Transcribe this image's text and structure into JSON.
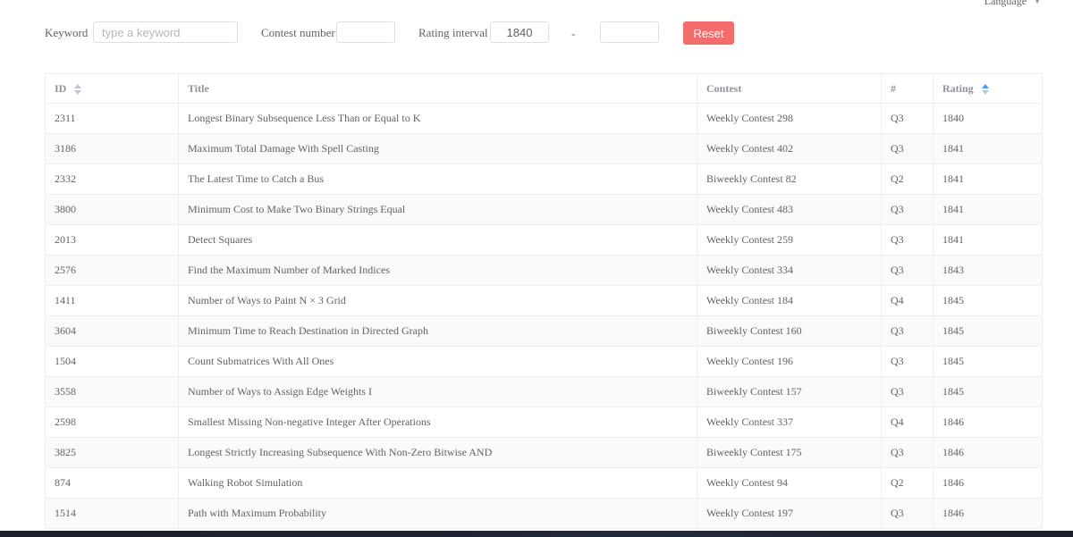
{
  "language": {
    "label": "Language"
  },
  "filters": {
    "keyword_label": "Keyword",
    "keyword_placeholder": "type a keyword",
    "keyword_value": "",
    "contest_label": "Contest number",
    "contest_value": "",
    "rating_label": "Rating interval",
    "rating_min": "1840",
    "rating_separator": "-",
    "rating_max": "",
    "reset_label": "Reset"
  },
  "table": {
    "columns": {
      "id": "ID",
      "title": "Title",
      "contest": "Contest",
      "num": "#",
      "rating": "Rating"
    },
    "rows": [
      {
        "id": "2311",
        "title": "Longest Binary Subsequence Less Than or Equal to K",
        "contest": "Weekly Contest 298",
        "q": "Q3",
        "rating": "1840"
      },
      {
        "id": "3186",
        "title": "Maximum Total Damage With Spell Casting",
        "contest": "Weekly Contest 402",
        "q": "Q3",
        "rating": "1841"
      },
      {
        "id": "2332",
        "title": "The Latest Time to Catch a Bus",
        "contest": "Biweekly Contest 82",
        "q": "Q2",
        "rating": "1841"
      },
      {
        "id": "3800",
        "title": "Minimum Cost to Make Two Binary Strings Equal",
        "contest": "Weekly Contest 483",
        "q": "Q3",
        "rating": "1841"
      },
      {
        "id": "2013",
        "title": "Detect Squares",
        "contest": "Weekly Contest 259",
        "q": "Q3",
        "rating": "1841"
      },
      {
        "id": "2576",
        "title": "Find the Maximum Number of Marked Indices",
        "contest": "Weekly Contest 334",
        "q": "Q3",
        "rating": "1843"
      },
      {
        "id": "1411",
        "title": "Number of Ways to Paint N × 3 Grid",
        "contest": "Weekly Contest 184",
        "q": "Q4",
        "rating": "1845"
      },
      {
        "id": "3604",
        "title": "Minimum Time to Reach Destination in Directed Graph",
        "contest": "Biweekly Contest 160",
        "q": "Q3",
        "rating": "1845"
      },
      {
        "id": "1504",
        "title": "Count Submatrices With All Ones",
        "contest": "Weekly Contest 196",
        "q": "Q3",
        "rating": "1845"
      },
      {
        "id": "3558",
        "title": "Number of Ways to Assign Edge Weights I",
        "contest": "Biweekly Contest 157",
        "q": "Q3",
        "rating": "1845"
      },
      {
        "id": "2598",
        "title": "Smallest Missing Non-negative Integer After Operations",
        "contest": "Weekly Contest 337",
        "q": "Q4",
        "rating": "1846"
      },
      {
        "id": "3825",
        "title": "Longest Strictly Increasing Subsequence With Non-Zero Bitwise AND",
        "contest": "Biweekly Contest 175",
        "q": "Q3",
        "rating": "1846"
      },
      {
        "id": "874",
        "title": "Walking Robot Simulation",
        "contest": "Weekly Contest 94",
        "q": "Q2",
        "rating": "1846"
      },
      {
        "id": "1514",
        "title": "Path with Maximum Probability",
        "contest": "Weekly Contest 197",
        "q": "Q3",
        "rating": "1846"
      }
    ]
  },
  "icons": {
    "sort": "sort-caret-icon",
    "language_dropdown": "chevron-down-icon"
  },
  "colors": {
    "reset_button": "#f56c6c",
    "sort_active": "#409eff"
  }
}
